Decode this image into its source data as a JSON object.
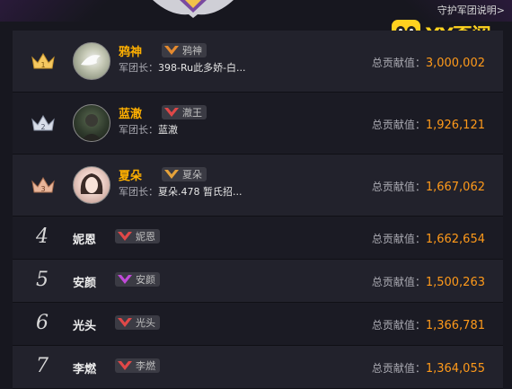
{
  "header": {
    "help_link": "守护军团说明>",
    "logo_text": "YY歪阅"
  },
  "labels": {
    "leader_prefix": "军团长：",
    "contribution_prefix": "总贡献值："
  },
  "entries": [
    {
      "rank": "1",
      "name": "鸦神",
      "badge": "鸦神",
      "leader": "398-Ru此多娇-白...",
      "contribution": "3,000,002"
    },
    {
      "rank": "2",
      "name": "蓝澈",
      "badge": "澈王",
      "leader": "蓝澈",
      "contribution": "1,926,121"
    },
    {
      "rank": "3",
      "name": "夏朵",
      "badge": "夏朵",
      "leader": "夏朵.478 暂氏招...",
      "contribution": "1,667,062"
    },
    {
      "rank": "4",
      "name": "妮恩",
      "badge": "妮恩",
      "contribution": "1,662,654"
    },
    {
      "rank": "5",
      "name": "安颜",
      "badge": "安颜",
      "contribution": "1,500,263"
    },
    {
      "rank": "6",
      "name": "光头",
      "badge": "光头",
      "contribution": "1,366,781"
    },
    {
      "rank": "7",
      "name": "李燃",
      "badge": "李燃",
      "contribution": "1,364,055"
    }
  ],
  "colors": {
    "gold_crown": "#f5c860",
    "silver_crown": "#d8dde8",
    "bronze_crown": "#e8b59a",
    "contribution_value": "#ff9a1a",
    "top_name": "#ffb000"
  }
}
